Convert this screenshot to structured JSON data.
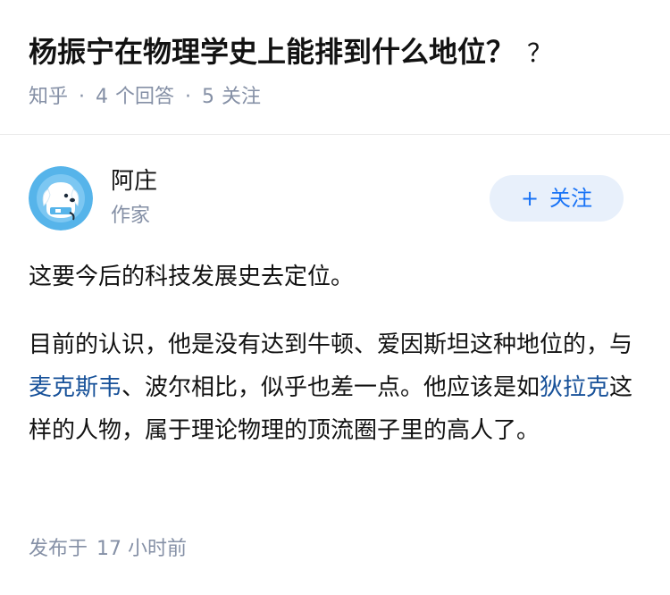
{
  "question": {
    "title": "杨振宁在物理学史上能排到什么地位？",
    "title_suffix": "？",
    "source": "知乎",
    "answer_count": "4",
    "answer_label": "个回答",
    "follower_count": "5",
    "follower_label": "关注"
  },
  "author": {
    "name": "阿庄",
    "headline": "作家",
    "follow_plus": "+",
    "follow_label": "关注",
    "avatar_icon": "dog-avatar-icon"
  },
  "answer": {
    "p1": "这要今后的科技发展史去定位。",
    "p2_a": "目前的认识，他是没有达到牛顿、爱因斯坦这种地位的，与",
    "p2_link1": "麦克斯韦",
    "p2_b": "、波尔相比，似乎也差一点。他应该是如",
    "p2_link2": "狄拉克",
    "p2_c": "这样的人物，属于理论物理的顶流圈子里的高人了。"
  },
  "footer": {
    "published_label": "发布于",
    "published_time": "17 小时前"
  },
  "colors": {
    "link": "#175199",
    "accent": "#1772f6",
    "meta": "#8590a6",
    "follow_bg": "#e8f0fb"
  }
}
